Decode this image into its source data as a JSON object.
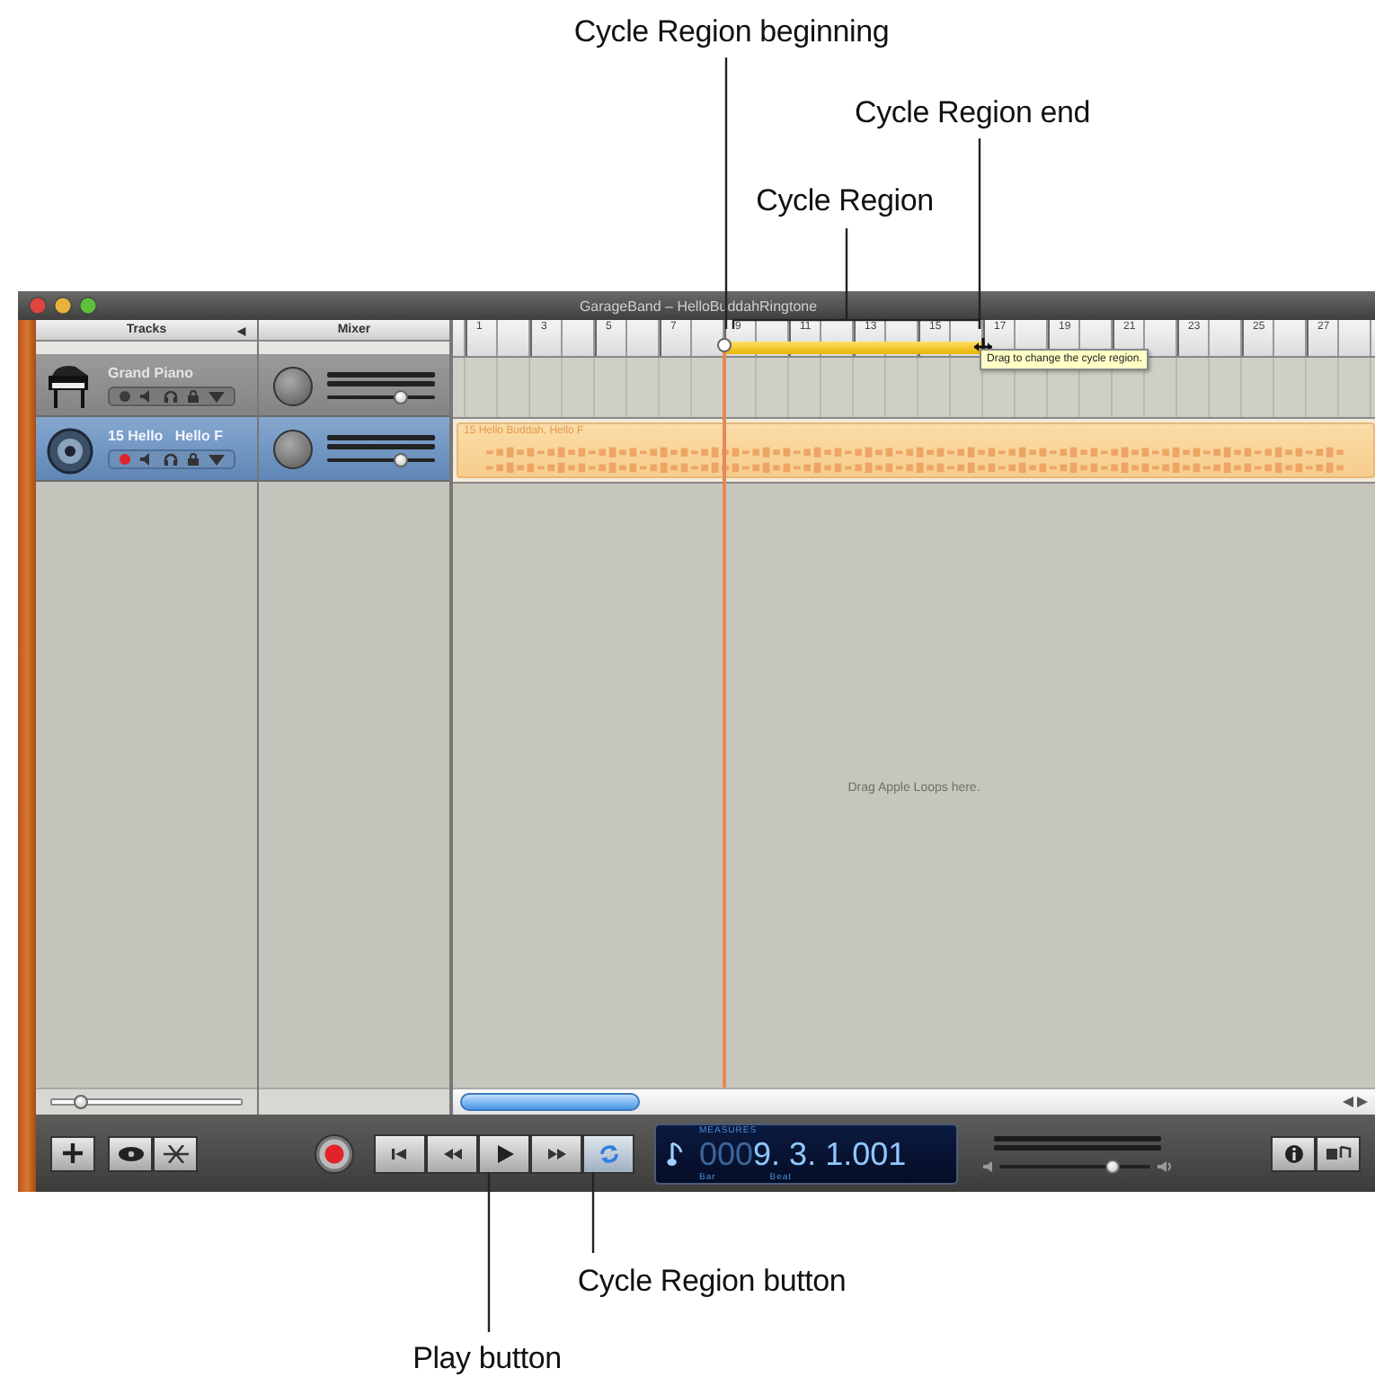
{
  "callouts": [
    {
      "text": "Cycle Region beginning",
      "kind": "beginning"
    },
    {
      "text": "Cycle Region end",
      "kind": "end"
    },
    {
      "text": "Cycle Region",
      "kind": "region"
    },
    {
      "text": "Cycle Region button",
      "kind": "cycle_button"
    },
    {
      "text": "Play button",
      "kind": "play_button"
    }
  ],
  "window": {
    "title": "GarageBand – HelloBuddahRingtone"
  },
  "columns": {
    "tracks": "Tracks",
    "tracks_toggle": "◀",
    "mixer": "Mixer"
  },
  "ruler": {
    "marks": [
      "1",
      "3",
      "5",
      "7",
      "9",
      "11",
      "13",
      "15",
      "17",
      "19",
      "21",
      "23",
      "25",
      "27"
    ]
  },
  "cycle_region": {
    "on": true
  },
  "tooltip": "Drag to change the cycle region.",
  "tracks": [
    {
      "name": "Grand Piano",
      "kind": "piano",
      "selected": false,
      "recording": false,
      "volume": {
        "level": 0.68
      }
    },
    {
      "name": "15 Hello   Hello F",
      "kind": "audio",
      "selected": true,
      "recording": true,
      "volume": {
        "level": 0.68
      },
      "region": {
        "name": "15 Hello Buddah, Hello F"
      }
    }
  ],
  "drop_hint": "Drag Apple Loops here.",
  "zoom_slider": {
    "level": 0.15
  },
  "transport": {
    "cycle": {
      "selected": true
    }
  },
  "lcd": {
    "label": "MEASURES",
    "dim_digits": "000",
    "time": "9. 3. 1.001",
    "bar_label": "Bar",
    "beat_label": "Beat"
  },
  "master_volume": {
    "level": 0.75
  }
}
